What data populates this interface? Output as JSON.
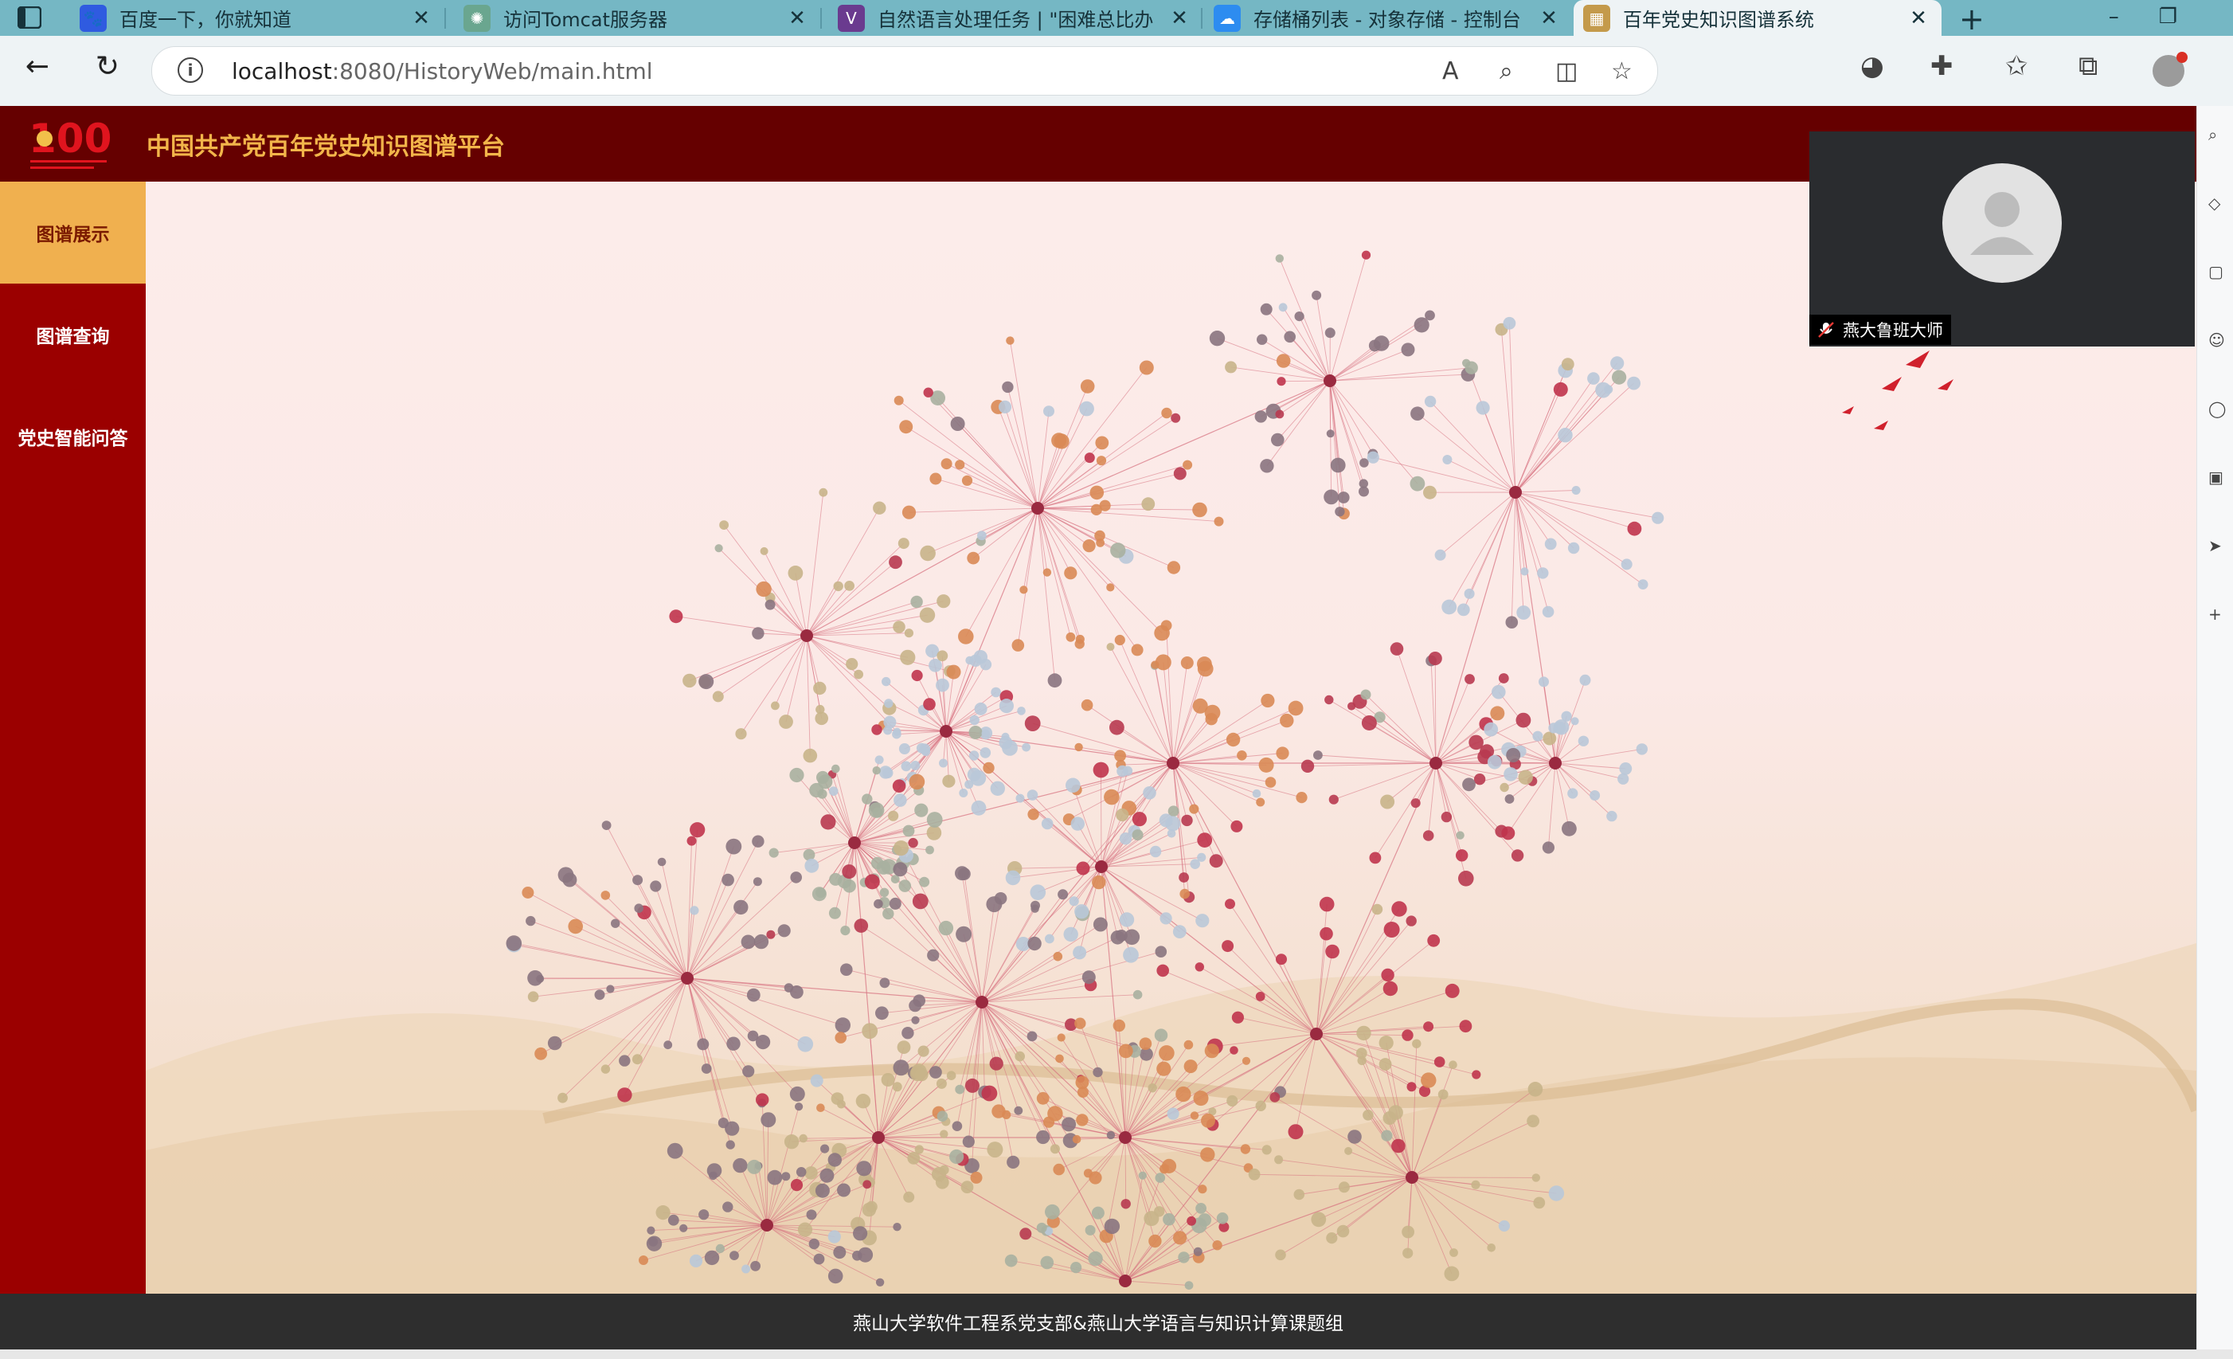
{
  "browser": {
    "tabs": [
      {
        "title": "百度一下，你就知道",
        "favicon": "baidu-paw-icon",
        "color": "#2f5be0",
        "active": false
      },
      {
        "title": "访问Tomcat服务器",
        "favicon": "chatgpt-icon",
        "color": "#6aa68f",
        "active": false
      },
      {
        "title": "自然语言处理任务 | \"困难总比办",
        "favicon": "vectorstore-v-icon",
        "color": "#6a3b8f",
        "active": false
      },
      {
        "title": "存储桶列表 - 对象存储 - 控制台",
        "favicon": "cloud-icon",
        "color": "#2d8cf0",
        "active": false
      },
      {
        "title": "百年党史知识图谱系统",
        "favicon": "page-icon",
        "color": "#c49a4b",
        "active": true
      }
    ],
    "close_glyph": "✕",
    "new_tab_glyph": "+",
    "url_host": "localhost",
    "url_rest": ":8080/HistoryWeb/main.html"
  },
  "app": {
    "title": "中国共产党百年党史知识图谱平台",
    "logo_text": "100",
    "sidebar": [
      {
        "label": "图谱展示",
        "active": true
      },
      {
        "label": "图谱查询",
        "active": false
      },
      {
        "label": "党史智能问答",
        "active": false
      }
    ],
    "footer": "燕山大学软件工程系党支部&燕山大学语言与知识计算课题组"
  },
  "video": {
    "name": "燕大鲁班大师"
  },
  "graph": {
    "node_colors": [
      "#c0344d",
      "#b83a50",
      "#c8b48a",
      "#8a7480",
      "#d98a55",
      "#b9c8d8",
      "#a9b0a0"
    ],
    "edge_color": "#d7707f"
  }
}
